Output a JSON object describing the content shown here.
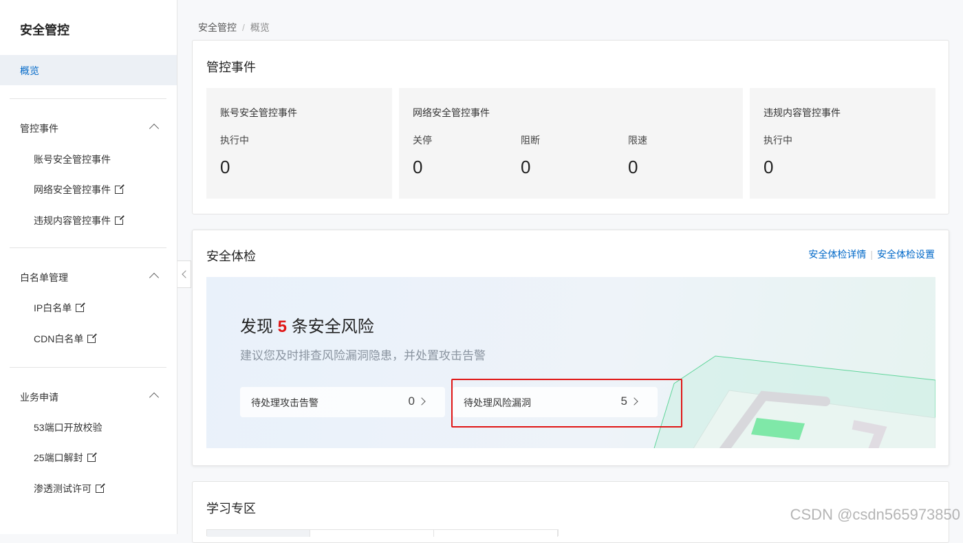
{
  "sidebar": {
    "title": "安全管控",
    "active": "概览",
    "groups": [
      {
        "label": "管控事件",
        "items": [
          "账号安全管控事件",
          "网络安全管控事件",
          "违规内容管控事件"
        ]
      },
      {
        "label": "白名单管理",
        "items": [
          "IP白名单",
          "CDN白名单"
        ]
      },
      {
        "label": "业务申请",
        "items": [
          "53端口开放校验",
          "25端口解封",
          "渗透测试许可"
        ]
      }
    ]
  },
  "breadcrumb": {
    "root": "安全管控",
    "sep": "/",
    "current": "概览"
  },
  "events": {
    "title": "管控事件",
    "account": {
      "title": "账号安全管控事件",
      "label": "执行中",
      "value": "0"
    },
    "network": {
      "title": "网络安全管控事件",
      "shutdown_label": "关停",
      "shutdown": "0",
      "block_label": "阻断",
      "block": "0",
      "limit_label": "限速",
      "limit": "0"
    },
    "content": {
      "title": "违规内容管控事件",
      "label": "执行中",
      "value": "0"
    }
  },
  "checkup": {
    "title": "安全体检",
    "detail_link": "安全体检详情",
    "settings_link": "安全体检设置",
    "heading_pre": "发现",
    "risk_count": "5",
    "heading_post": "条安全风险",
    "subtitle": "建议您及时排查风险漏洞隐患，并处置攻击告警",
    "alerts_label": "待处理攻击告警",
    "alerts_count": "0",
    "vulns_label": "待处理风险漏洞",
    "vulns_count": "5"
  },
  "learning": {
    "title": "学习专区"
  },
  "watermark": "CSDN @csdn565973850"
}
